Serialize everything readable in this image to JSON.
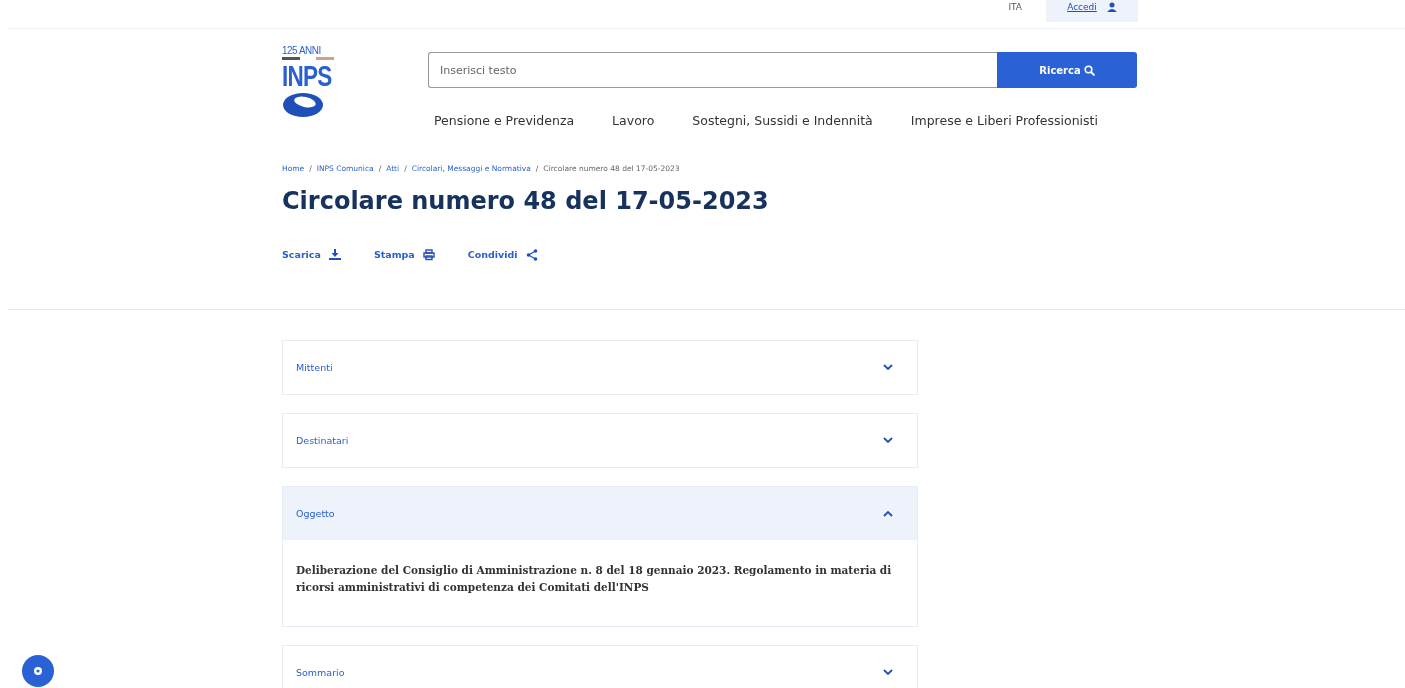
{
  "top_bar": {
    "language": "ITA",
    "login": "Accedi"
  },
  "logo": {
    "anniversary": "125 ANNI",
    "name": "INPS"
  },
  "search": {
    "placeholder": "Inserisci testo",
    "button": "Ricerca"
  },
  "nav": [
    "Pensione e Previdenza",
    "Lavoro",
    "Sostegni, Sussidi e Indennità",
    "Imprese e Liberi Professionisti"
  ],
  "breadcrumb": [
    {
      "label": "Home",
      "link": true
    },
    {
      "separator": "/",
      "label": "INPS Comunica",
      "link": true
    },
    {
      "separator": "/",
      "label": "Atti",
      "link": true
    },
    {
      "separator": "/",
      "label": "Circolari, Messaggi e Normativa",
      "link": true
    },
    {
      "separator": "/",
      "label": "Circolare numero 48 del 17-05-2023",
      "link": false
    }
  ],
  "title": "Circolare numero 48 del 17-05-2023",
  "actions": [
    {
      "label": "Scarica",
      "kind": "download"
    },
    {
      "label": "Stampa",
      "kind": "print"
    },
    {
      "label": "Condividi",
      "kind": "share"
    }
  ],
  "accordion": [
    {
      "title": "Mittenti",
      "expanded": false
    },
    {
      "title": "Destinatari",
      "expanded": false
    },
    {
      "title": "Oggetto",
      "expanded": true,
      "body": "Deliberazione del Consiglio di Amministrazione n. 8 del 18 gennaio 2023. Regolamento in materia di ricorsi amministrativi di competenza dei Comitati dell'INPS"
    },
    {
      "title": "Sommario",
      "expanded": false
    }
  ]
}
